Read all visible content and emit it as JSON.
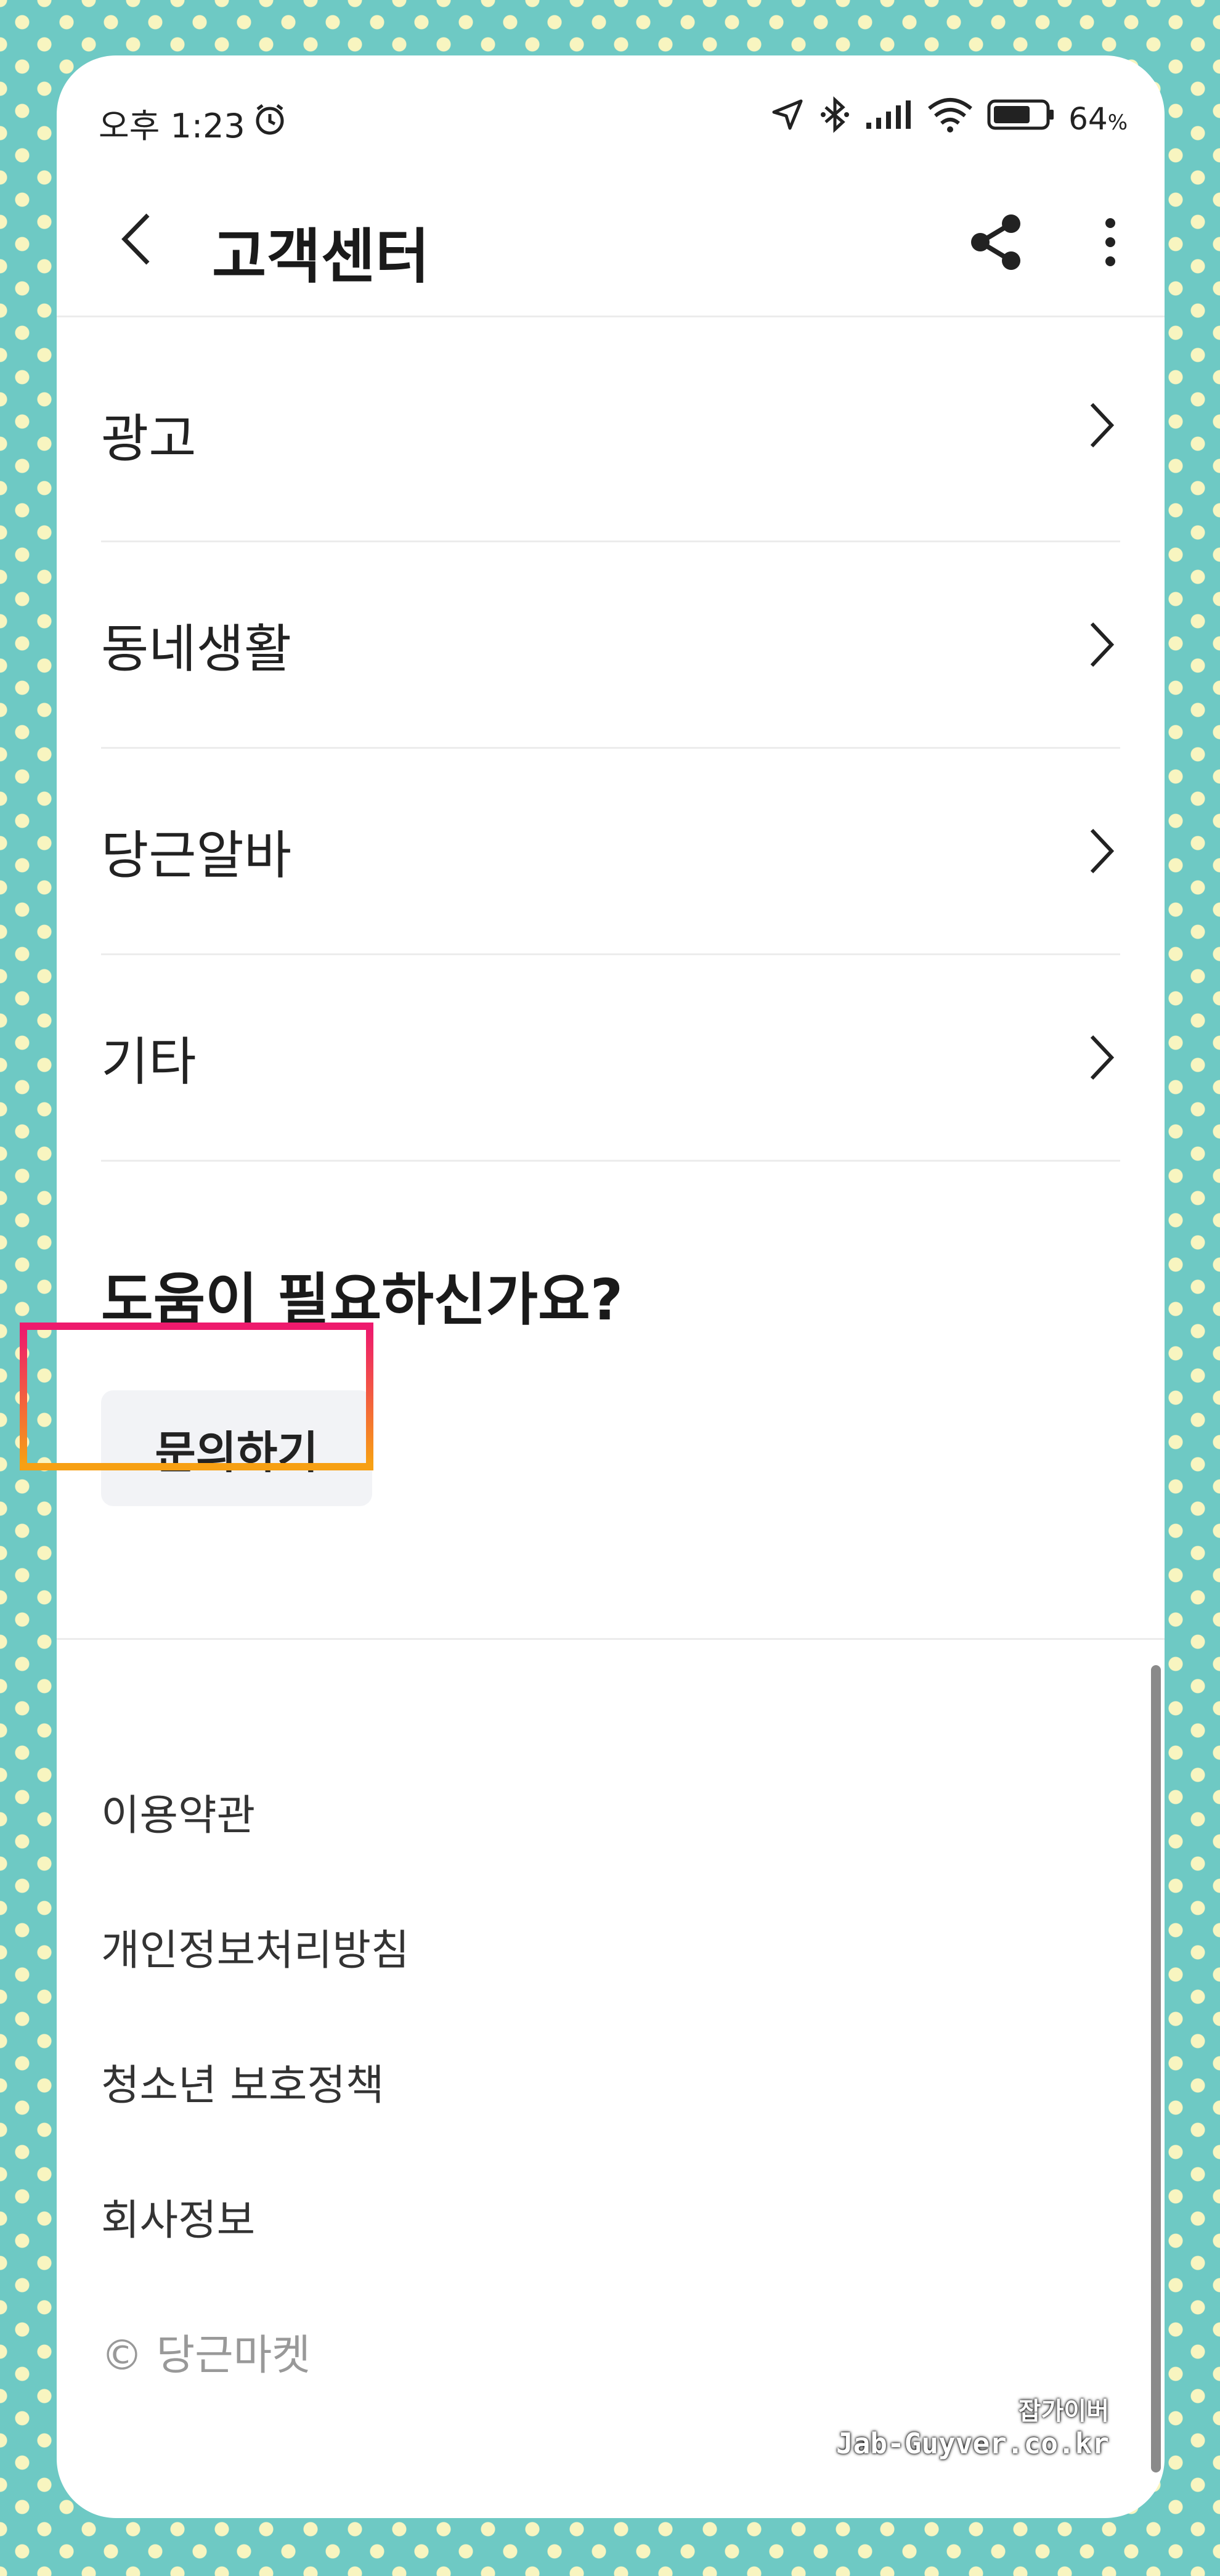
{
  "status_bar": {
    "time": "오후 1:23",
    "battery": "64",
    "battery_unit": "%",
    "icons": [
      "alarm-icon",
      "location-icon",
      "bluetooth-icon",
      "signal-icon",
      "wifi-icon",
      "battery-icon"
    ]
  },
  "header": {
    "title": "고객센터"
  },
  "categories": [
    {
      "label": "광고"
    },
    {
      "label": "동네생활"
    },
    {
      "label": "당근알바"
    },
    {
      "label": "기타"
    }
  ],
  "help": {
    "title": "도움이 필요하신가요?",
    "button_label": "문의하기",
    "highlight_colors": [
      "#ee1a6d",
      "#f7a013"
    ]
  },
  "footer": {
    "links": [
      "이용약관",
      "개인정보처리방침",
      "청소년 보호정책",
      "회사정보"
    ],
    "copyright": "© 당근마켓"
  },
  "watermark": {
    "korean": "잡가이버",
    "english": "Jab-Guyver.co.kr"
  },
  "colors": {
    "background": "#6ec9c4",
    "dots": "#f8f5c0",
    "text": "#222222",
    "muted": "#999999",
    "button_bg": "#f2f3f6"
  }
}
